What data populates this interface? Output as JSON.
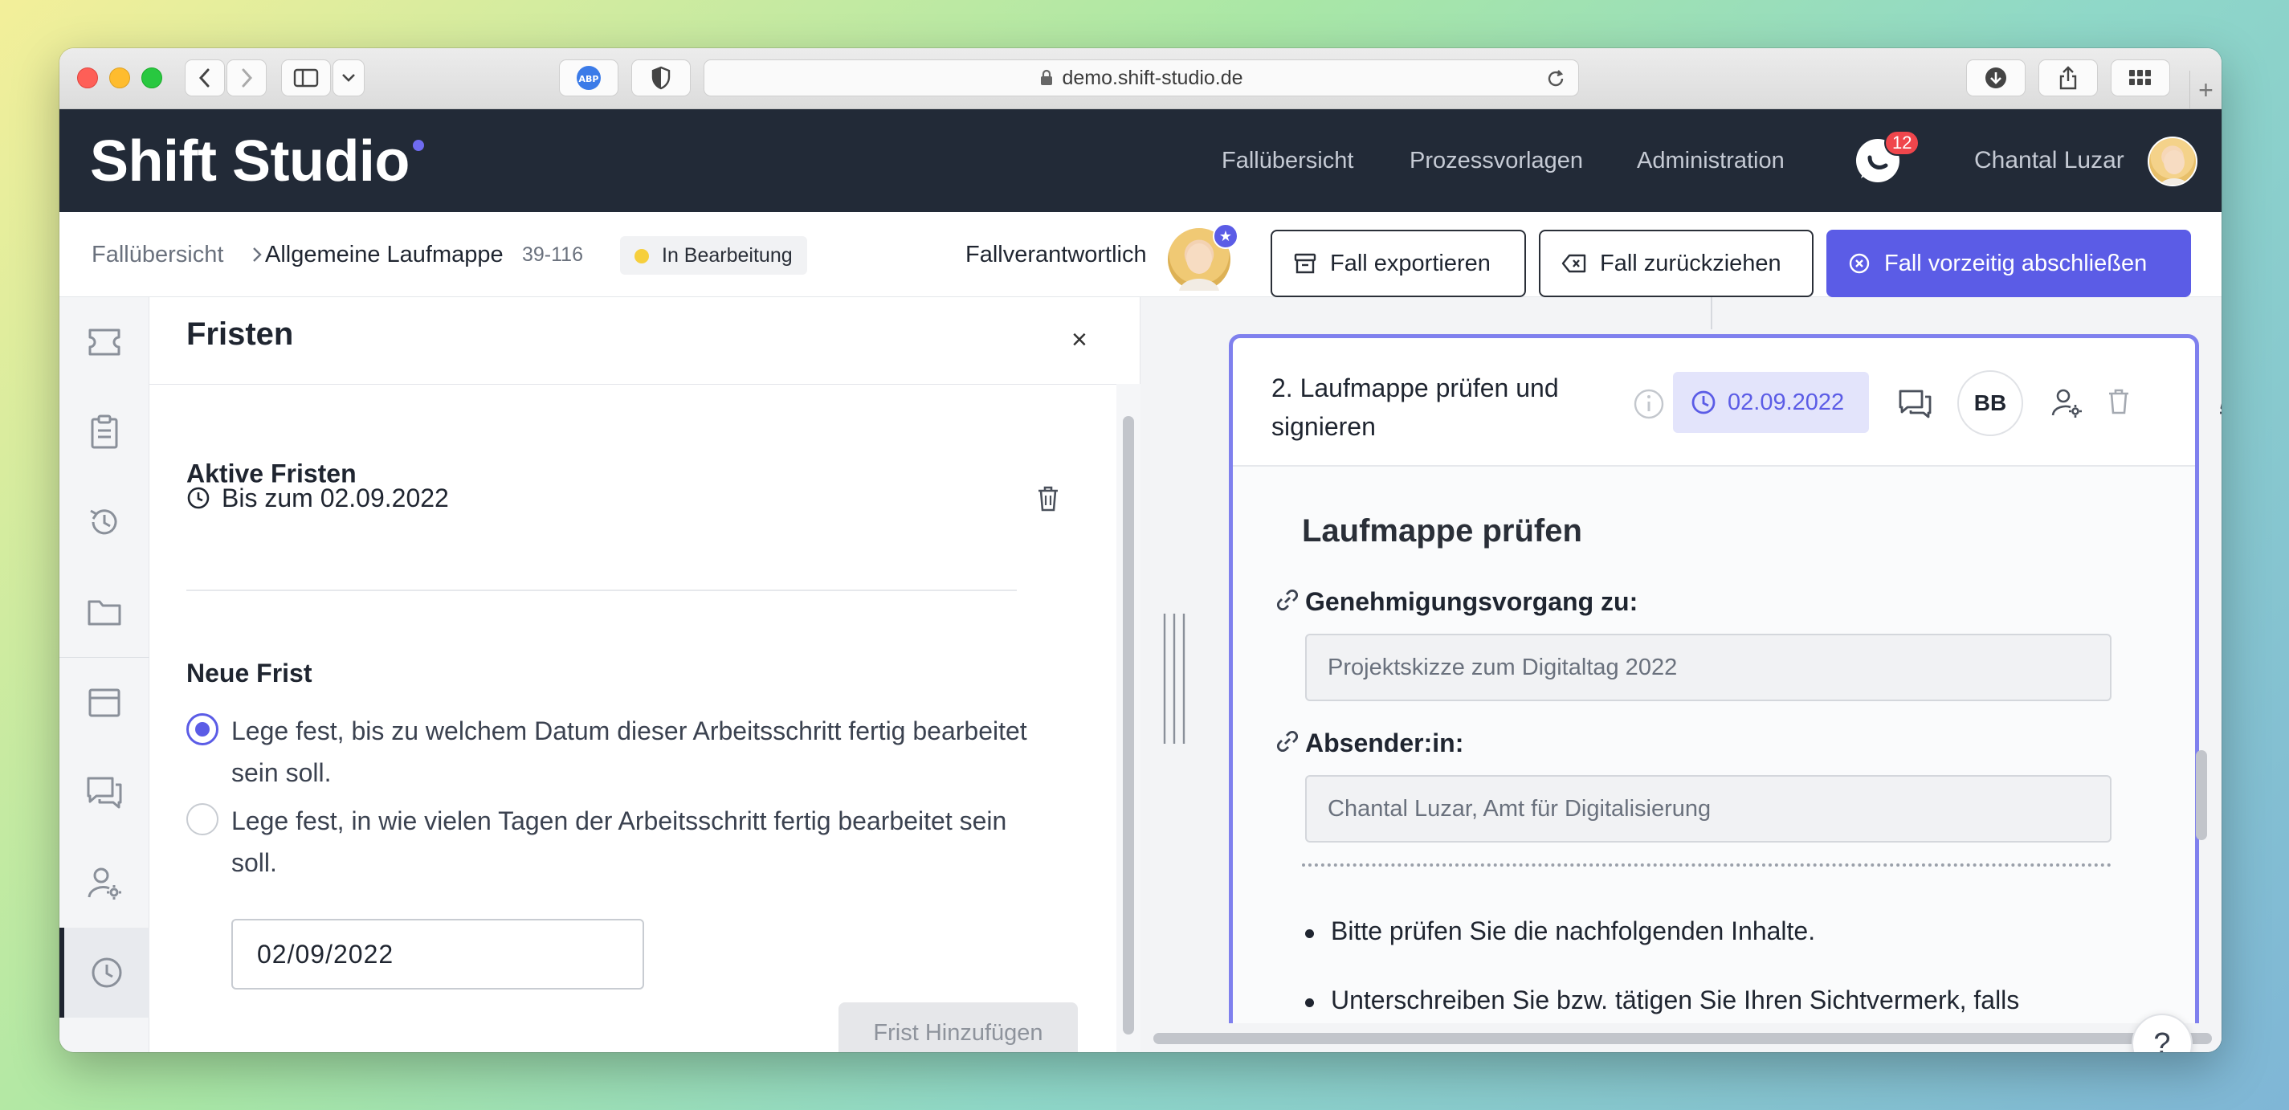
{
  "browser": {
    "url": "demo.shift-studio.de"
  },
  "app": {
    "logo": "Shift Studio",
    "nav": [
      "Fallübersicht",
      "Prozessvorlagen",
      "Administration"
    ],
    "notifications_count": "12",
    "user_name": "Chantal Luzar"
  },
  "case": {
    "breadcrumb_root": "Fallübersicht",
    "breadcrumb_sep": ">",
    "title": "Allgemeine Laufmappe",
    "id": "39-116",
    "status": "In Bearbeitung",
    "responsible_label": "Fallverantwortlich",
    "export_label": "Fall exportieren",
    "withdraw_label": "Fall zurückziehen",
    "close_early_label": "Fall vorzeitig abschließen"
  },
  "deadlines_panel": {
    "title": "Fristen",
    "close": "×",
    "active_title": "Aktive Fristen",
    "active_deadline": "Bis zum 02.09.2022",
    "new_title": "Neue Frist",
    "option_date": "Lege fest, bis zu welchem Datum dieser Arbeitsschritt fertig bearbeitet sein soll.",
    "option_days": "Lege fest, in wie vielen Tagen der Arbeitsschritt fertig bearbeitet sein soll.",
    "date_value": "02/09/2022",
    "add_button": "Frist Hinzufügen"
  },
  "step": {
    "title": "2. Laufmappe prüfen und signieren",
    "deadline_chip": "02.09.2022",
    "assignee_initials": "BB",
    "form_title": "Laufmappe prüfen",
    "field_1_label": "Genehmigungsvorgang zu:",
    "field_1_value": "Projektskizze zum Digitaltag 2022",
    "field_2_label": "Absender:in:",
    "field_2_value": "Chantal Luzar, Amt für Digitalisierung",
    "bullets": [
      "Bitte prüfen Sie die nachfolgenden Inhalte.",
      "Unterschreiben Sie bzw. tätigen Sie Ihren Sichtvermerk, falls"
    ]
  },
  "help_label": "?",
  "colors": {
    "header_bg": "#222a37",
    "accent": "#5b5ce6",
    "status_dot": "#f6cf3d",
    "badge": "#f0464c"
  }
}
